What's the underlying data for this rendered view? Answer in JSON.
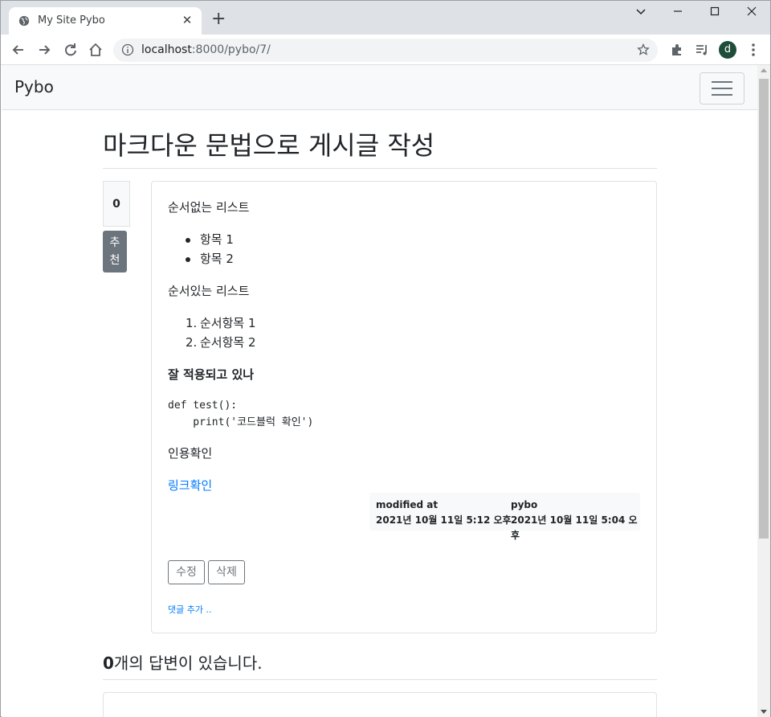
{
  "browser": {
    "tab_title": "My Site Pybo",
    "url_host": "localhost",
    "url_path": ":8000/pybo/7/",
    "profile_initial": "d"
  },
  "navbar": {
    "brand": "Pybo"
  },
  "question": {
    "subject": "마크다운 문법으로 게시글 작성",
    "vote_count": "0",
    "vote_button": "추천",
    "content": {
      "unordered_heading": "순서없는 리스트",
      "unordered_items": [
        "항목 1",
        "항목 2"
      ],
      "ordered_heading": "순서있는 리스트",
      "ordered_items": [
        "순서항목 1",
        "순서항목 2"
      ],
      "bold_text": "잘 적용되고 있나",
      "code_line1": "def test():",
      "code_line2": "    print('코드블럭 확인')",
      "quote_text": "인용확인",
      "link_text": "링크확인"
    },
    "meta": {
      "modified_label": "modified at",
      "modified_date": "2021년 10월 11일 5:12 오후",
      "author": "pybo",
      "created_date": "2021년 10월 11일 5:04 오후"
    },
    "edit_button": "수정",
    "delete_button": "삭제",
    "add_comment": "댓글 추가 .."
  },
  "answers": {
    "count": "0",
    "title_suffix": "개의 답변이 있습니다."
  }
}
